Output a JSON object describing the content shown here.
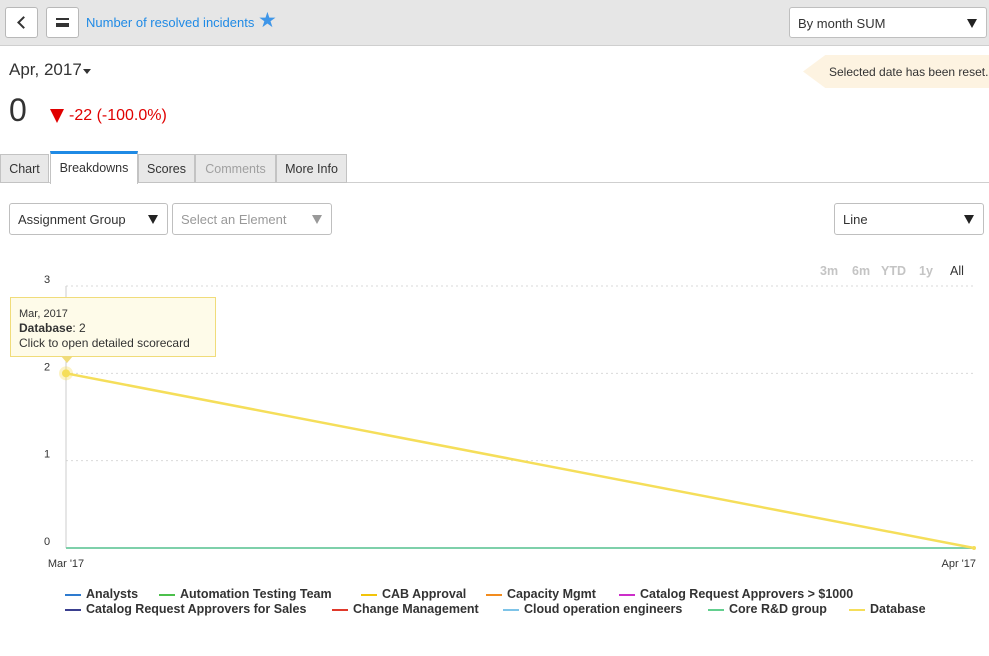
{
  "header": {
    "title": "Number of resolved incidents",
    "period_select": "By month SUM",
    "icons": {
      "back": "back-icon",
      "menu": "menu-icon",
      "favorite": "star-icon"
    }
  },
  "summary": {
    "date": "Apr, 2017",
    "value": "0",
    "change": "-22 (-100.0%)",
    "notice": "Selected date has been reset."
  },
  "tabs": [
    {
      "label": "Chart"
    },
    {
      "label": "Breakdowns",
      "active": true
    },
    {
      "label": "Scores"
    },
    {
      "label": "Comments",
      "disabled": true
    },
    {
      "label": "More Info"
    }
  ],
  "filters": {
    "breakdown": "Assignment Group",
    "element_placeholder": "Select an Element",
    "chart_type": "Line"
  },
  "time_ranges": [
    "3m",
    "6m",
    "YTD",
    "1y",
    "All"
  ],
  "active_time_range": "All",
  "tooltip": {
    "date": "Mar, 2017",
    "series": "Database",
    "value": ": 2",
    "hint": "Click to open detailed scorecard"
  },
  "colors": {
    "accent": "#1f8ae5",
    "negative": "#e00000",
    "database": "#f5de5a",
    "flat_series": "#7fd0a9"
  },
  "chart_data": {
    "type": "line",
    "x": [
      "Mar '17",
      "Apr '17"
    ],
    "ylim": [
      0,
      3
    ],
    "yticks": [
      "0",
      "1",
      "2",
      "3"
    ],
    "grid": true,
    "legend_position": "bottom",
    "series": [
      {
        "name": "Analysts",
        "color": "#2e7bcf",
        "values": [
          0,
          0
        ]
      },
      {
        "name": "Automation Testing Team",
        "color": "#4cc04c",
        "values": [
          0,
          0
        ]
      },
      {
        "name": "CAB Approval",
        "color": "#f2c40a",
        "values": [
          0,
          0
        ]
      },
      {
        "name": "Capacity Mgmt",
        "color": "#f28c1e",
        "values": [
          0,
          0
        ]
      },
      {
        "name": "Catalog Request Approvers > $1000",
        "color": "#cc2ec9",
        "values": [
          0,
          0
        ]
      },
      {
        "name": "Catalog Request Approvers for Sales",
        "color": "#3a3f8f",
        "values": [
          0,
          0
        ]
      },
      {
        "name": "Change Management",
        "color": "#e0392b",
        "values": [
          0,
          0
        ]
      },
      {
        "name": "Cloud operation engineers",
        "color": "#7ec4e8",
        "values": [
          0,
          0
        ]
      },
      {
        "name": "Core R&D group",
        "color": "#63cf8f",
        "values": [
          0,
          0
        ]
      },
      {
        "name": "Database",
        "color": "#f5de5a",
        "values": [
          2,
          0
        ]
      }
    ]
  }
}
